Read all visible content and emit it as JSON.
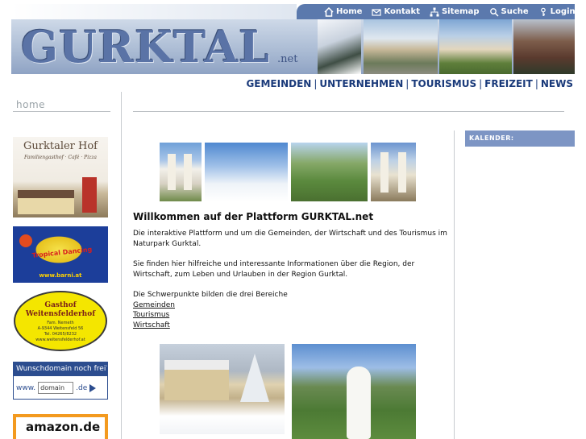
{
  "site": {
    "logo_main": "GURKTAL",
    "logo_suffix": ".net"
  },
  "topnav": {
    "items": [
      {
        "label": "Home",
        "icon": "house-icon"
      },
      {
        "label": "Kontakt",
        "icon": "envelope-icon"
      },
      {
        "label": "Sitemap",
        "icon": "sitemap-icon"
      },
      {
        "label": "Suche",
        "icon": "magnifier-icon"
      },
      {
        "label": "Login",
        "icon": "key-icon"
      }
    ]
  },
  "mainnav": {
    "items": [
      "GEMEINDEN",
      "UNTERNEHMEN",
      "TOURISMUS",
      "FREIZEIT",
      "NEWS"
    ],
    "separator": "|"
  },
  "sidebar": {
    "home_label": "home",
    "ads": {
      "hof": {
        "title": "Gurktaler Hof",
        "subtitle": "Familiengasthof · Café · Pizza"
      },
      "bar": {
        "name": "Tropical Dancing",
        "url": "www.barni.at"
      },
      "gasthof": {
        "line1": "Gasthof",
        "line2": "Weitensfelderhof",
        "details": [
          "Fam. Nemeth",
          "A-9344 Weitensfeld 56",
          "Tel. 04265/8232",
          "www.weitensfelderhof.at"
        ]
      },
      "domain": {
        "heading": "Wunschdomain noch frei?",
        "prefix": "www.",
        "input_value": "domain",
        "suffix": ".de"
      },
      "amazon": {
        "label": "amazon.de"
      }
    }
  },
  "main": {
    "title": "Willkommen auf der Plattform GURKTAL.net",
    "paragraph1": "Die interaktive Plattform und um die Gemeinden, der Wirtschaft und des Tourismus im Naturpark Gurktal.",
    "paragraph2": "Sie finden hier hilfreiche und interessante Informationen über die Region, der Wirtschaft, zum Leben und Urlauben in der Region Gurktal.",
    "paragraph3": "Die Schwerpunkte bilden die drei Bereiche",
    "links": [
      "Gemeinden",
      "Tourismus",
      "Wirtschaft"
    ]
  },
  "calendar": {
    "heading": "KALENDER:"
  },
  "colors": {
    "nav_blue": "#5b79ad",
    "link_navy": "#1a3a7a",
    "calendar_blue": "#7d95c4"
  }
}
